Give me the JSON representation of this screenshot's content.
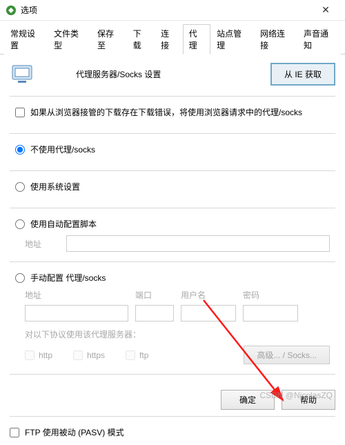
{
  "window": {
    "title": "选项",
    "close": "✕"
  },
  "tabs": {
    "items": [
      {
        "label": "常规设置"
      },
      {
        "label": "文件类型"
      },
      {
        "label": "保存至"
      },
      {
        "label": "下载"
      },
      {
        "label": "连接"
      },
      {
        "label": "代理"
      },
      {
        "label": "站点管理"
      },
      {
        "label": "网络连接"
      },
      {
        "label": "声音通知"
      }
    ],
    "active_index": 5
  },
  "header": {
    "title": "代理服务器/Socks 设置",
    "ie_button": "从 IE 获取"
  },
  "browser_checkbox": {
    "label": "如果从浏览器接管的下载存在下载错误，将使用浏览器请求中的代理/socks",
    "checked": false
  },
  "radios": {
    "no_proxy": "不使用代理/socks",
    "system": "使用系统设置",
    "auto_cfg": "使用自动配置脚本",
    "manual": "手动配置 代理/socks",
    "selected": "no_proxy"
  },
  "auto_cfg": {
    "addr_label": "地址",
    "addr_value": ""
  },
  "manual": {
    "addr_label": "地址",
    "port_label": "端口",
    "user_label": "用户名",
    "pass_label": "密码",
    "addr_value": "",
    "port_value": "",
    "user_value": "",
    "pass_value": "",
    "protocols_caption": "对以下协议使用该代理服务器：",
    "proto_http": "http",
    "proto_https": "https",
    "proto_ftp": "ftp",
    "advanced_button": "高级... / Socks..."
  },
  "ftp_pasv": {
    "label": "FTP 使用被动 (PASV) 模式",
    "checked": false
  },
  "buttons": {
    "ok": "确定",
    "help": "帮助"
  },
  "watermark": "CSDN @NicolasZQ"
}
